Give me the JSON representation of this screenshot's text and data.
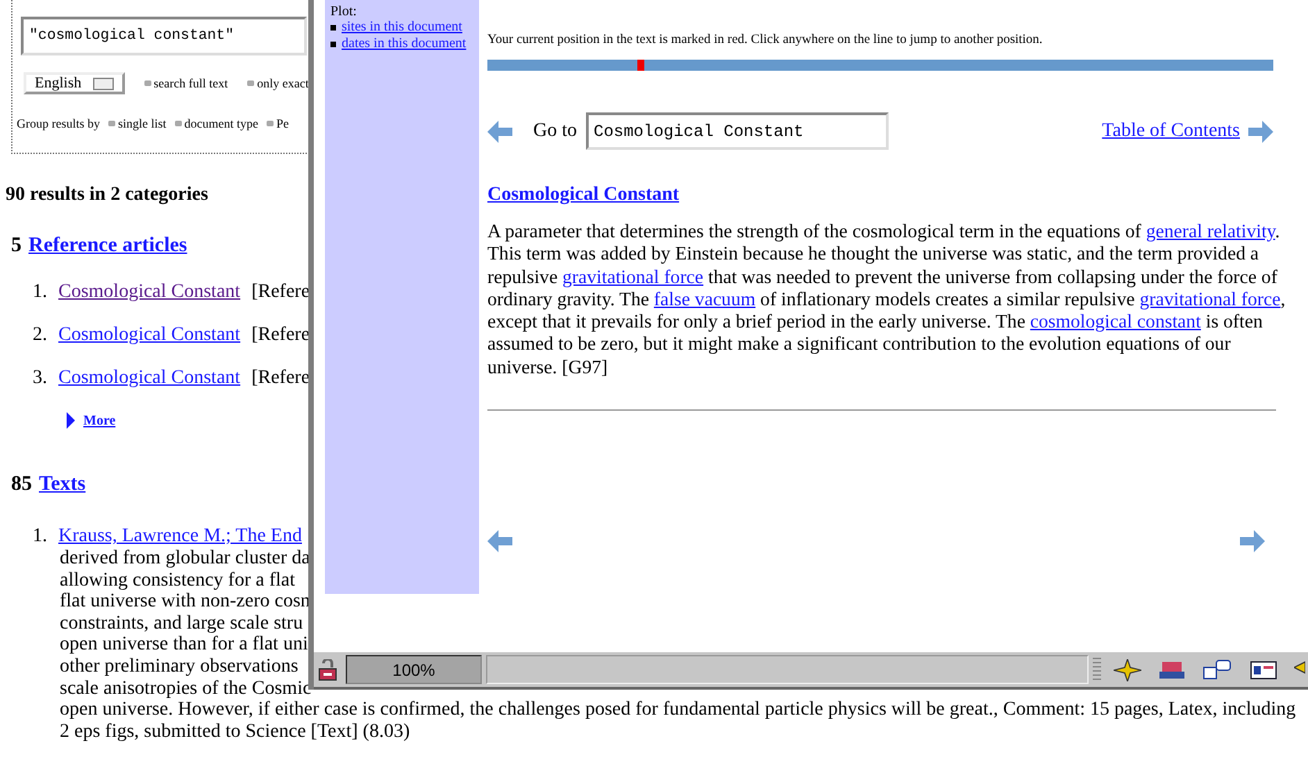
{
  "search_form": {
    "query": "\"cosmological constant\"",
    "language": "English",
    "options": [
      "search full text",
      "only exact"
    ],
    "group_label": "Group results by",
    "group_options": [
      "single list",
      "document type",
      "Pe"
    ]
  },
  "results": {
    "summary": "90 results in 2 categories",
    "categories": [
      {
        "count": "5",
        "title": "Reference articles",
        "more": "More",
        "items": [
          {
            "number": "1.",
            "link": "Cosmological Constant",
            "visited": true,
            "suffix": "[Refere"
          },
          {
            "number": "2.",
            "link": "Cosmological Constant",
            "visited": false,
            "suffix": "[Refere"
          },
          {
            "number": "3.",
            "link": "Cosmological Constant",
            "visited": false,
            "suffix": "[Refere"
          }
        ]
      },
      {
        "count": "85",
        "title": "Texts",
        "items": [
          {
            "number": "1.",
            "link": "Krauss, Lawrence M.; The End",
            "visited": false,
            "lines": [
              "derived from globular cluster da",
              "allowing consistency for a flat",
              "flat universe with non-zero cosn",
              "constraints, and large scale stru",
              "open universe than for a flat uni",
              "other preliminary observations",
              "scale anisotropies of the Cosmic",
              "open universe. However, if either case is confirmed, the challenges posed for fundamental particle physics will be great., Comment: 15 pages, Latex, including",
              "2 eps figs, submitted to Science [Text] (8.03)"
            ]
          }
        ]
      }
    ]
  },
  "document_window": {
    "sidebar": {
      "heading": "Plot:",
      "links": [
        "sites in this document",
        "dates in this document"
      ]
    },
    "position_bar": {
      "instructions": "Your current position in the text is marked in red. Click anywhere on the line to jump to another position.",
      "level": 0.19
    },
    "navigation": {
      "goto_label": "Go to",
      "goto_value": "Cosmological Constant",
      "toc_link": "Table of Contents"
    },
    "article": {
      "title": "Cosmological Constant",
      "body": [
        {
          "kind": "text",
          "text": "A parameter that determines the strength of the cosmological term in the equations of "
        },
        {
          "kind": "link",
          "text": "general relativity"
        },
        {
          "kind": "text",
          "text": ". This term was added by Einstein because he thought the universe was static, and the term provided a repulsive "
        },
        {
          "kind": "link",
          "text": "gravitational force"
        },
        {
          "kind": "text",
          "text": " that was needed to prevent the universe from collapsing under the force of ordinary gravity. The "
        },
        {
          "kind": "link",
          "text": "false vacuum"
        },
        {
          "kind": "text",
          "text": " of inflationary models creates a similar repulsive "
        },
        {
          "kind": "link",
          "text": "gravitational force"
        },
        {
          "kind": "text",
          "text": ", except that it prevails for only a brief period in the early universe. The "
        },
        {
          "kind": "link",
          "text": "cosmological constant"
        },
        {
          "kind": "text",
          "text": " is often assumed to be zero, but it might make a significant contribution to the evolution equations of our universe. [G97]"
        }
      ]
    },
    "status_bar": {
      "zoom": "100%"
    }
  }
}
